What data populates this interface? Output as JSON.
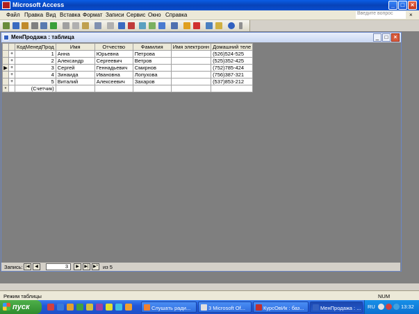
{
  "app": {
    "title": "Microsoft Access"
  },
  "menu": {
    "items": [
      "Файл",
      "Правка",
      "Вид",
      "Вставка",
      "Формат",
      "Записи",
      "Сервис",
      "Окно",
      "Справка"
    ],
    "ask_placeholder": "Введите вопрос"
  },
  "document": {
    "title": "МенПродажа : таблица"
  },
  "table": {
    "columns": [
      "КодМенедПрод",
      "Имя",
      "Отчество",
      "Фамилия",
      "Имя электронн",
      "Домашний теле"
    ],
    "rows": [
      {
        "expand": "+",
        "id": "1",
        "first": "Анна",
        "middle": "Юрьевна",
        "last": "Петрова",
        "email": "",
        "phone": "(526)524-525"
      },
      {
        "expand": "+",
        "id": "2",
        "first": "Александр",
        "middle": "Сергеевич",
        "last": "Ветров",
        "email": "",
        "phone": "(525)352-425"
      },
      {
        "expand": "+",
        "id": "3",
        "first": "Сергей",
        "middle": "Геннадьевич",
        "last": "Смирнов",
        "email": "",
        "phone": "(752)785-424"
      },
      {
        "expand": "+",
        "id": "4",
        "first": "Зинаида",
        "middle": "Ивановна",
        "last": "Лопухова",
        "email": "",
        "phone": "(756)387-321"
      },
      {
        "expand": "+",
        "id": "5",
        "first": "Виталий",
        "middle": "Алексеевич",
        "last": "Захаров",
        "email": "",
        "phone": "(537)853-212"
      }
    ],
    "new_row_marker": "*",
    "new_row_id": "(Счетчик)",
    "current_row_marker": "▶",
    "current_row_index": 2
  },
  "navigation": {
    "label": "Запись:",
    "current": "3",
    "total_text": "из 5"
  },
  "status": {
    "mode": "Режим таблицы",
    "num": "NUM"
  },
  "taskbar": {
    "start_label": "пуск",
    "tasks": [
      "Слушать ради...",
      "3 Microsoft Of...",
      "КурсОвИк : баз...",
      "МенПродажа : ..."
    ],
    "language": "RU",
    "clock": "13:32"
  },
  "colors": {
    "titlebar": "#0a4fd0",
    "workspace": "#808080",
    "taskbar": "#2158d8",
    "start": "#2e8b2e"
  }
}
